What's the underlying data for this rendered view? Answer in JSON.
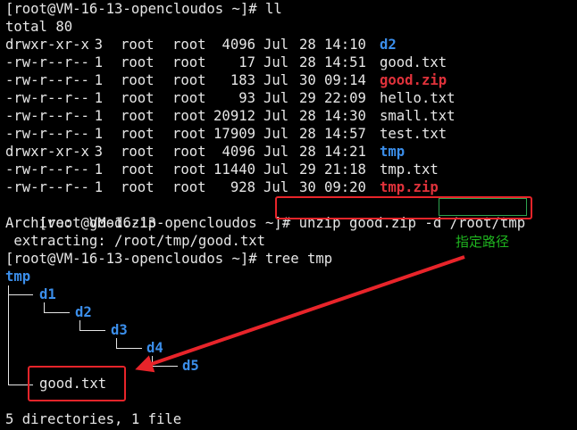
{
  "prompt1": "[root@VM-16-13-opencloudos ~]# ll",
  "total": "total 80",
  "listing": [
    {
      "perm": "drwxr-xr-x",
      "links": "3",
      "owner": "root",
      "group": "root",
      "size": "4096",
      "month": "Jul",
      "day": "28",
      "time": "14:10",
      "name": "d2",
      "kind": "dir"
    },
    {
      "perm": "-rw-r--r--",
      "links": "1",
      "owner": "root",
      "group": "root",
      "size": "17",
      "month": "Jul",
      "day": "28",
      "time": "14:51",
      "name": "good.txt",
      "kind": "file"
    },
    {
      "perm": "-rw-r--r--",
      "links": "1",
      "owner": "root",
      "group": "root",
      "size": "183",
      "month": "Jul",
      "day": "30",
      "time": "09:14",
      "name": "good.zip",
      "kind": "zip"
    },
    {
      "perm": "-rw-r--r--",
      "links": "1",
      "owner": "root",
      "group": "root",
      "size": "93",
      "month": "Jul",
      "day": "29",
      "time": "22:09",
      "name": "hello.txt",
      "kind": "file"
    },
    {
      "perm": "-rw-r--r--",
      "links": "1",
      "owner": "root",
      "group": "root",
      "size": "20912",
      "month": "Jul",
      "day": "28",
      "time": "14:30",
      "name": "small.txt",
      "kind": "file"
    },
    {
      "perm": "-rw-r--r--",
      "links": "1",
      "owner": "root",
      "group": "root",
      "size": "17909",
      "month": "Jul",
      "day": "28",
      "time": "14:57",
      "name": "test.txt",
      "kind": "file"
    },
    {
      "perm": "drwxr-xr-x",
      "links": "3",
      "owner": "root",
      "group": "root",
      "size": "4096",
      "month": "Jul",
      "day": "28",
      "time": "14:21",
      "name": "tmp",
      "kind": "dir"
    },
    {
      "perm": "-rw-r--r--",
      "links": "1",
      "owner": "root",
      "group": "root",
      "size": "11440",
      "month": "Jul",
      "day": "29",
      "time": "21:18",
      "name": "tmp.txt",
      "kind": "file"
    },
    {
      "perm": "-rw-r--r--",
      "links": "1",
      "owner": "root",
      "group": "root",
      "size": "928",
      "month": "Jul",
      "day": "30",
      "time": "09:20",
      "name": "tmp.zip",
      "kind": "zip"
    }
  ],
  "prompt2": "[root@VM-16-13-opencloudos ~]# ",
  "unzip_cmd": "unzip good.zip -d /root/tmp",
  "archive": "Archive:  good.zip",
  "extracting": " extracting: /root/tmp/good.txt",
  "prompt3": "[root@VM-16-13-opencloudos ~]# tree tmp",
  "tree": {
    "root": "tmp",
    "d1": "d1",
    "d2": "d2",
    "d3": "d3",
    "d4": "d4",
    "d5": "d5",
    "file": "good.txt"
  },
  "summary": "5 directories, 1 file",
  "annotation": "指定路径",
  "colors": {
    "dir": "#3b8eea",
    "zip": "#e0323b",
    "annotation_box": "#e8242a",
    "annotation_text": "#1fb41f"
  }
}
